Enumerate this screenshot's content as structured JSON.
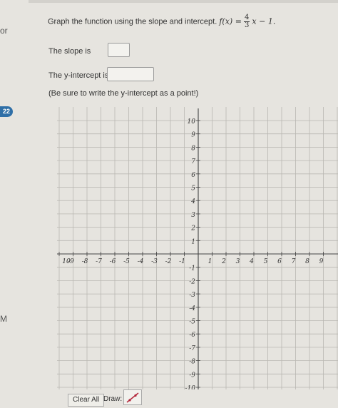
{
  "side": {
    "fragment_top": "or",
    "badge": "22",
    "fragment_bottom": "M"
  },
  "question": {
    "prompt_text": "Graph the function using the slope and intercept.",
    "function_lhs": "f(x) =",
    "frac_num": "4",
    "frac_den": "3",
    "function_rhs": "x − 1.",
    "slope_label": "The slope is",
    "yint_label": "The y-intercept is",
    "note": "(Be sure to write the y-intercept as a point!)"
  },
  "inputs": {
    "slope_value": "",
    "yint_value": ""
  },
  "graph": {
    "x_ticks": [
      "10",
      "-9",
      "-8",
      "-7",
      "-6",
      "-5",
      "-4",
      "-3",
      "-2",
      "-1",
      "1",
      "2",
      "3",
      "4",
      "5",
      "6",
      "7",
      "8",
      "9"
    ],
    "y_ticks": [
      "10",
      "9",
      "8",
      "7",
      "6",
      "5",
      "4",
      "3",
      "2",
      "1",
      "-1",
      "-2",
      "-3",
      "-4",
      "-5",
      "-6",
      "-7",
      "-8",
      "-9",
      "-10"
    ],
    "grid": true
  },
  "toolbar": {
    "clear_label": "Clear All",
    "draw_label": "Draw:",
    "tool_icon": "line-tool-icon"
  },
  "colors": {
    "badge": "#2f6fa7",
    "tool_line": "#b3263a"
  }
}
